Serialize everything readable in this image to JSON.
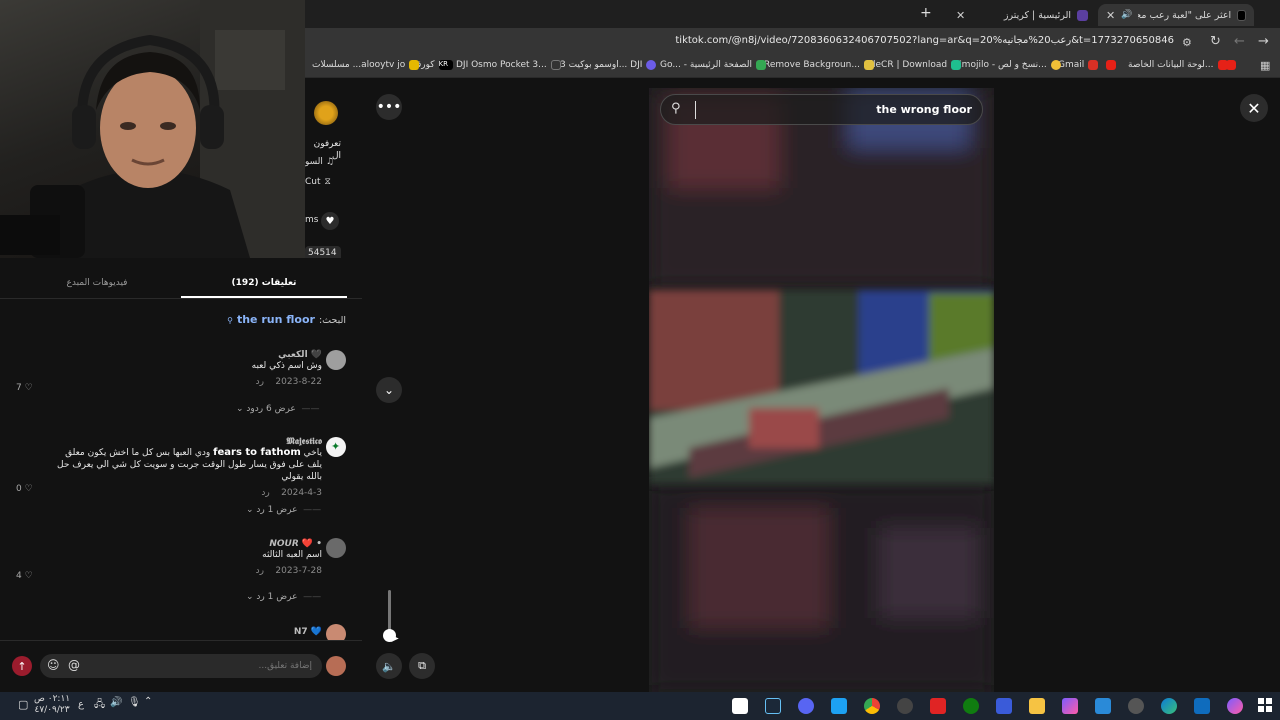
{
  "browser": {
    "tabs": [
      {
        "label": "اعثر على \"لعبة رعب مجانيه ...",
        "active": true
      },
      {
        "label": "الرئيسية | كريترز",
        "active": false
      }
    ],
    "url": "tiktok.com/@n8j/video/7208360632406707502?lang=ar&q=20%رعب20%مجانيه&t=1773270650846",
    "bookmarks": [
      "مسلسلات ...alooytv jo",
      "كورقر",
      "DJI Osmo Pocket 3...",
      "اوسمو بوكيت 3... DJI",
      "Go... - الصفحة الرئيسية",
      "Remove Backgroun...",
      "FileCR | Download",
      "Emojilo - نسخ و لص...",
      "Gmail",
      "لوحة البيانات الخاصة..."
    ]
  },
  "video_info": {
    "caption_partial": "تعرفون ال",
    "sound_partial": "السو",
    "capcut_label": "Cut",
    "likes_partial": "ms",
    "number_partial": "54514"
  },
  "panel": {
    "tab_comments": "تعليقات (192)",
    "tab_videos": "فيديوهات المبدع",
    "search_prefix": "البحث:",
    "search_term": "the run floor"
  },
  "comments": [
    {
      "name": "الكعبي 🖤",
      "text": "وش اسم ذكي لعبه",
      "date": "2023-8-22",
      "reply": "رد",
      "likes": "7",
      "replies": "عرض 6 ردود"
    },
    {
      "name": "𝕸𝖆𝖏𝖊𝖘𝖙𝖎𝖈𝖔",
      "text_pre": "ياخي ",
      "text_bold": "fears to fathom",
      "text_post": " ودي العبها بس كل ما اخش يكون معلق يلف على فوق يسار طول الوقت جربت و سويت كل شي الي يعرف حل بالله يقولي",
      "date": "2024-4-3",
      "reply": "رد",
      "likes": "0",
      "replies": "عرض 1 رد"
    },
    {
      "name": "𝙉𝙊𝙐𝙍 ❤️ •",
      "text": "اسم العبه الثالثه",
      "date": "2023-7-28",
      "reply": "رد",
      "likes": "4",
      "replies": "عرض 1 رد"
    },
    {
      "name": "N7 💙",
      "text": "",
      "date": "",
      "reply": "",
      "likes": "",
      "replies": ""
    }
  ],
  "comment_input": {
    "placeholder": "إضافة تعليق..."
  },
  "search": {
    "value": "the wrong floor"
  },
  "volume": {
    "level": 0.05
  },
  "taskbar": {
    "time": "٠٢:١١ ص",
    "date": "٤٧/٠٩/٢٣",
    "lang": "ع"
  },
  "colors": {
    "accent": "#fe2c55",
    "link": "#8ab4f8",
    "background": "#121212"
  }
}
